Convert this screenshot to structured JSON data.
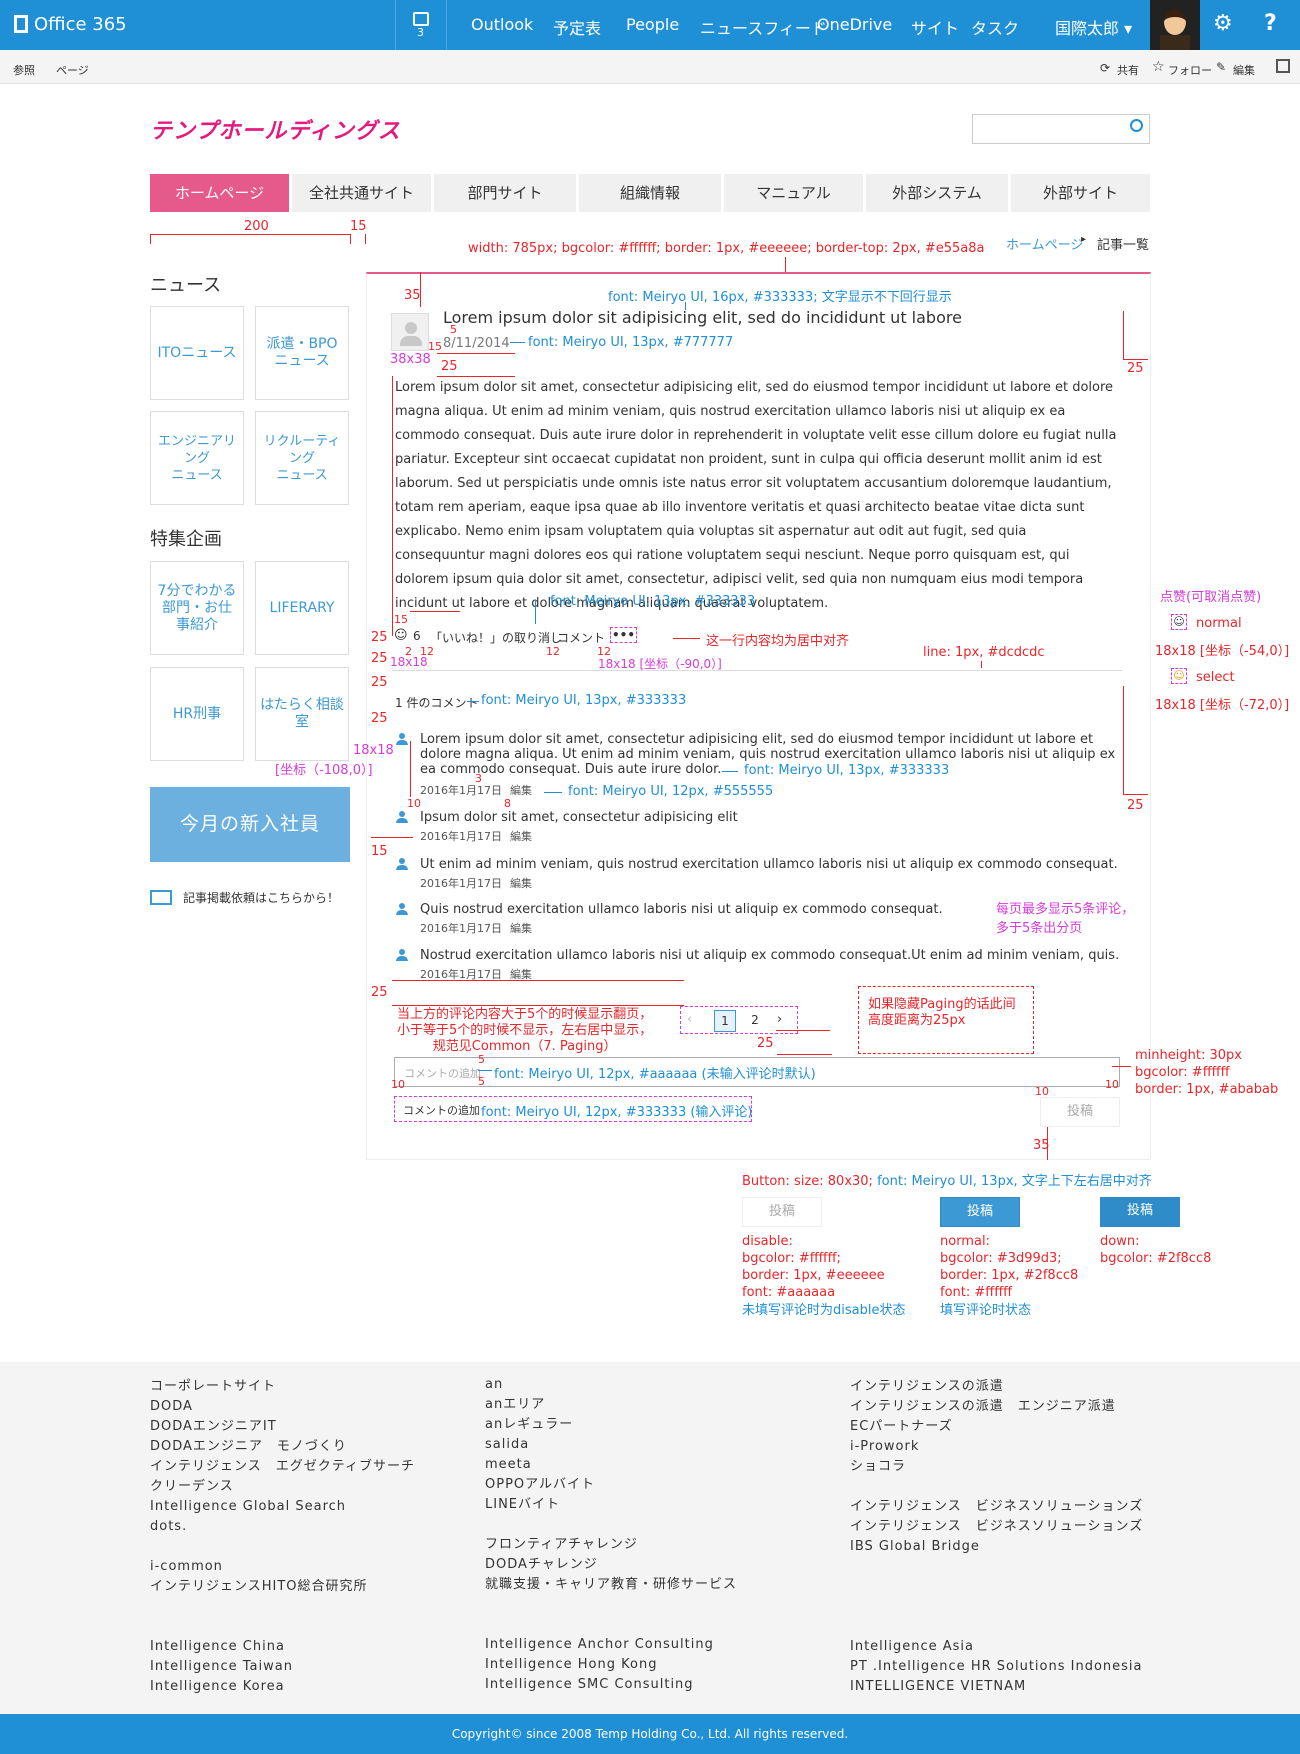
{
  "topbar": {
    "brand": "Office 365",
    "notif_count": "3",
    "nav": [
      "Outlook",
      "予定表",
      "People",
      "ニュースフィード",
      "OneDrive",
      "サイト",
      "タスク"
    ],
    "user": "国際太郎 ▾",
    "gear": "⚙",
    "help": "?"
  },
  "ribbon": {
    "left": [
      "参照",
      "ページ"
    ],
    "right": [
      "共有",
      "フォロー",
      "編集"
    ]
  },
  "logo": "テンプホールディングス",
  "tabs": [
    "ホームページ",
    "全社共通サイト",
    "部門サイト",
    "組織情報",
    "マニュアル",
    "外部システム",
    "外部サイト"
  ],
  "breadcrumb": {
    "home": "ホームページ",
    "sep": "▸",
    "current": "記事一覧"
  },
  "sidebar": {
    "news_heading": "ニュース",
    "news_tiles": [
      "ITOニュース",
      "派遣・BPO\nニュース",
      "エンジニアリング\nニュース",
      "リクルーティング\nニュース"
    ],
    "feature_heading": "特集企画",
    "feature_tiles": [
      "7分でわかる\n部門・お仕\n事紹介",
      "LIFERARY",
      "HR刑事",
      "はたらく相談室"
    ],
    "newhire": "今月の新入社員",
    "mail_link": "記事掲載依頼はこちらから！"
  },
  "article": {
    "title": "Lorem ipsum dolor sit adipisicing elit, sed do incididunt ut labore",
    "date": "8/11/2014",
    "body": "Lorem ipsum dolor sit amet, consectetur adipisicing elit, sed do eiusmod tempor incididunt ut labore et dolore magna aliqua. Ut enim ad minim veniam, quis nostrud exercitation ullamco laboris nisi ut aliquip ex ea commodo consequat. Duis aute irure dolor in reprehenderit in voluptate velit esse cillum dolore eu fugiat nulla pariatur. Excepteur sint occaecat cupidatat non proident, sunt in culpa qui officia deserunt mollit anim id est laborum. Sed ut perspiciatis unde omnis iste natus error sit voluptatem accusantium doloremque laudantium, totam rem aperiam, eaque ipsa quae ab illo inventore veritatis et quasi architecto beatae vitae dicta sunt explicabo. Nemo enim ipsam voluptatem quia voluptas sit aspernatur aut odit aut fugit, sed quia consequuntur magni dolores eos qui ratione voluptatem sequi nesciunt. Neque porro quisquam est, qui dolorem ipsum quia dolor sit amet, consectetur, adipisci velit, sed quia non numquam eius modi tempora incidunt ut labore et dolore magnam aliquam quaerat voluptatem.",
    "like_count": "6",
    "like_action": "「いいね！」の取り消し",
    "comment_link": "コメント",
    "more": "•••",
    "comment_count": "1 件のコメント"
  },
  "comments": [
    {
      "text": "Lorem ipsum dolor sit amet, consectetur adipisicing elit, sed do eiusmod tempor incididunt ut labore et dolore magna aliqua. Ut enim ad minim veniam, quis nostrud exercitation ullamco laboris nisi ut aliquip ex ea commodo consequat. Duis aute irure dolor.",
      "date": "2016年1月17日",
      "edit": "編集"
    },
    {
      "text": "Ipsum dolor sit amet, consectetur adipisicing elit",
      "date": "2016年1月17日",
      "edit": "編集"
    },
    {
      "text": "Ut enim ad minim veniam, quis nostrud exercitation ullamco laboris nisi ut aliquip ex commodo consequat.",
      "date": "2016年1月17日",
      "edit": "編集"
    },
    {
      "text": "Quis nostrud exercitation ullamco laboris nisi ut aliquip ex commodo consequat.",
      "date": "2016年1月17日",
      "edit": "編集"
    },
    {
      "text": "Nostrud exercitation ullamco laboris nisi ut aliquip ex commodo consequat.Ut enim ad minim veniam, quis.",
      "date": "2016年1月17日",
      "edit": "編集"
    }
  ],
  "paging": {
    "prev": "‹",
    "pages": [
      "1",
      "2"
    ],
    "next": "›"
  },
  "comment_input": {
    "placeholder": "コメントの追加",
    "typed": "コメントの追加"
  },
  "post_button": "投稿",
  "annotations": {
    "a200": "200",
    "a15": "15",
    "box": "width: 785px; bgcolor: #ffffff; border: 1px, #eeeeee; border-top: 2px, #e55a8a",
    "title_font": "font: Meiryo UI, 16px, #333333; 文字显示不下回行显示",
    "date_font": "font: Meiryo UI, 13px, #777777",
    "a35": "35",
    "a5": "5",
    "a15b": "15",
    "a38": "38x38",
    "a25": "25",
    "body_font": "font: Meiryo UI, 13px, #333333",
    "center_row": "这一行内容均为居中对齐",
    "line": "line: 1px, #dcdcdc",
    "like_ann_title": "点赞(可取消点赞)",
    "normal": "normal",
    "select": "select",
    "coord54": "18x18 [坐标（-54,0）]",
    "coord72": "18x18 [坐标（-72,0）]",
    "coord90": "18x18 [坐标（-90,0）]",
    "r2": "2",
    "r12": "12",
    "r18": "18x18",
    "count_font": "font: Meiryo UI, 13px, #333333",
    "coord108": "[坐标（-108,0）]",
    "cm_font": "font: Meiryo UI, 13px, #333333",
    "meta_font": "font: Meiryo UI, 12px, #555555",
    "r10": "10",
    "r8": "8",
    "r3": "3",
    "per_page": "每页最多显示5条评论，\n多于5条出分页",
    "paging_rule": "当上方的评论内容大于5个的时候显示翻页，\n小于等于5个的时候不显示，左右居中显示，\n规范见Common（7. Paging）",
    "paging_hidden": "如果隐藏Paging的话此间\n高度距离为25px",
    "input_font": "font: Meiryo UI, 12px, #aaaaaa (未输入评论时默认)",
    "typed_font": "font: Meiryo UI, 12px, #333333 (输入评论)",
    "minh": "minheight: 30px\nbgcolor: #ffffff\nborder: 1px, #ababab",
    "btn_spec": "Button: size: 80x30; ",
    "btn_font": "font: Meiryo UI, 13px, 文字上下左右居中对齐",
    "disable_spec": "disable:\nbgcolor: #ffffff;\nborder: 1px, #eeeeee\nfont: #aaaaaa",
    "disable_note": "未填写评论时为disable状态",
    "normal_spec": "normal:\nbgcolor: #3d99d3;\nborder: 1px, #2f8cc8\nfont: #ffffff",
    "normal_note": "填写评论时状态",
    "down_spec": "down:\nbgcolor: #2f8cc8"
  },
  "footer": {
    "col1": [
      "コーポレートサイト",
      "DODA",
      "DODAエンジニアIT",
      "DODAエンジニア　モノづくり",
      "インテリジェンス　エグゼクティブサーチ",
      "クリーデンス",
      "Intelligence Global Search",
      "dots.",
      "",
      "i-common",
      "インテリジェンスHITO総合研究所",
      "",
      "",
      "Intelligence China",
      "Intelligence Taiwan",
      "Intelligence Korea"
    ],
    "col2": [
      "an",
      "anエリア",
      "anレギュラー",
      "salida",
      "meeta",
      "OPPOアルバイト",
      "LINEバイト",
      "",
      "フロンティアチャレンジ",
      "DODAチャレンジ",
      "就職支援・キャリア教育・研修サービス",
      "",
      "",
      "Intelligence Anchor Consulting",
      "Intelligence Hong Kong",
      "Intelligence SMC Consulting"
    ],
    "col3": [
      "インテリジェンスの派遣",
      "インテリジェンスの派遣　エンジニア派遣",
      "ECパートナーズ",
      "i-Prowork",
      "ショコラ",
      "",
      "インテリジェンス　ビジネスソリューションズ",
      "インテリジェンス　ビジネスソリューションズ",
      "IBS Global Bridge",
      "",
      "",
      "",
      "",
      "Intelligence Asia",
      "PT .Intelligence HR Solutions Indonesia",
      "INTELLIGENCE VIETNAM"
    ],
    "copyright": "Copyright© since 2008 Temp Holding Co., Ltd. All rights reserved."
  },
  "colors": {
    "brand_blue": "#1f8fd6",
    "accent_pink": "#e55a8a",
    "logo_pink": "#e6197e",
    "button_blue": "#3d99d3",
    "button_down": "#2f8cc8"
  }
}
